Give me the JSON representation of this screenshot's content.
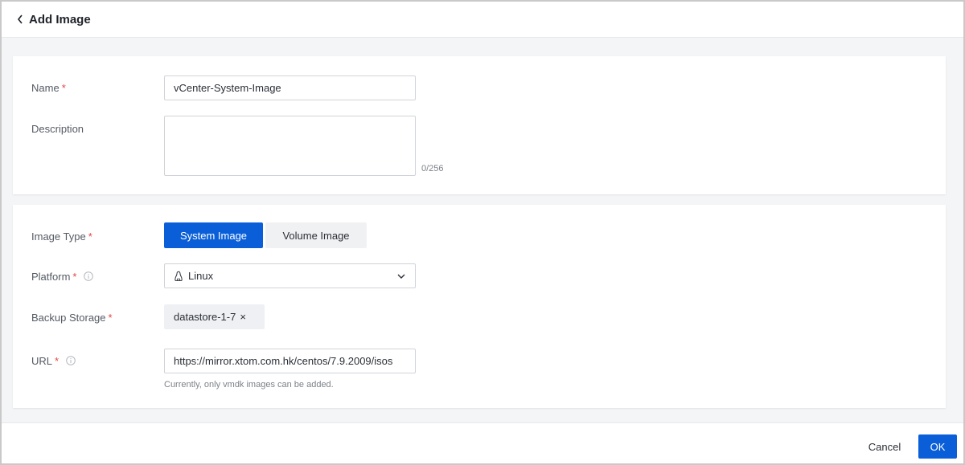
{
  "header": {
    "title": "Add Image",
    "back_icon": "chevron-left-icon"
  },
  "basic": {
    "name": {
      "label": "Name",
      "required": "*",
      "value": "vCenter-System-Image"
    },
    "description": {
      "label": "Description",
      "value": "",
      "counter": "0/256"
    }
  },
  "config": {
    "image_type": {
      "label": "Image Type",
      "required": "*",
      "options": [
        "System Image",
        "Volume Image"
      ],
      "selected": "System Image"
    },
    "platform": {
      "label": "Platform",
      "required": "*",
      "info_icon": "info-icon",
      "value": "Linux",
      "value_icon": "linux-icon",
      "dropdown_icon": "chevron-down-icon"
    },
    "backup_storage": {
      "label": "Backup Storage",
      "required": "*",
      "tag": "datastore-1-7",
      "remove": "×"
    },
    "url": {
      "label": "URL",
      "required": "*",
      "info_icon": "info-icon",
      "value": "https://mirror.xtom.com.hk/centos/7.9.2009/isos",
      "hint": "Currently, only vmdk images can be added."
    }
  },
  "footer": {
    "cancel_label": "Cancel",
    "ok_label": "OK"
  },
  "colors": {
    "primary": "#0a5fd8",
    "required": "#e54545",
    "background": "#f4f5f7"
  }
}
